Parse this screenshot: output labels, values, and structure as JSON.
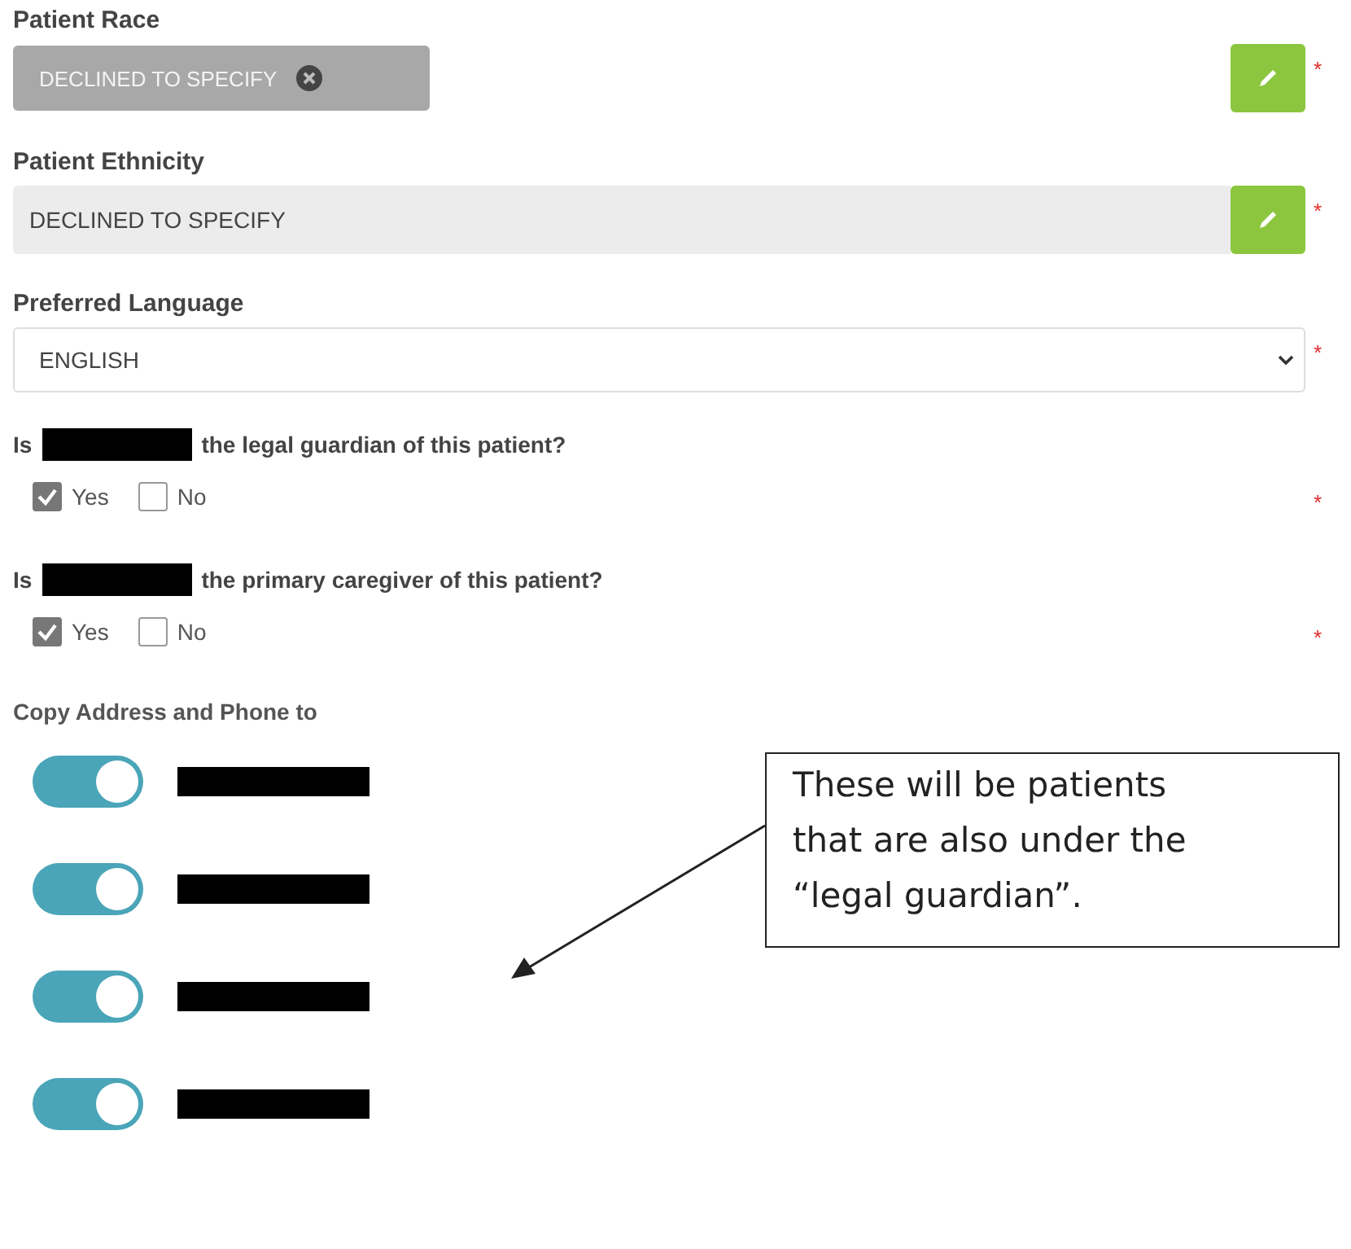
{
  "fields": [
    {
      "kind": "chip",
      "label": "Patient Race",
      "value": "DECLINED TO SPECIFY",
      "required_mark": "*"
    },
    {
      "kind": "text",
      "label": "Patient Ethnicity",
      "value": "DECLINED TO SPECIFY",
      "required_mark": "*"
    },
    {
      "kind": "select",
      "label": "Preferred Language",
      "value": "ENGLISH",
      "required_mark": "*"
    }
  ],
  "questions": [
    {
      "prefix": "Is",
      "text": "the legal guardian of this patient?",
      "required_mark": "*",
      "options": [
        {
          "label": "Yes",
          "checked": true
        },
        {
          "label": "No",
          "checked": false
        }
      ]
    },
    {
      "prefix": "Is",
      "text": "the primary caregiver of this patient?",
      "required_mark": "*",
      "options": [
        {
          "label": "Yes",
          "checked": true
        },
        {
          "label": "No",
          "checked": false
        }
      ]
    }
  ],
  "copy": {
    "label": "Copy Address and Phone to",
    "toggles": [
      {
        "on": true
      },
      {
        "on": true
      },
      {
        "on": true
      },
      {
        "on": true
      }
    ]
  },
  "callout": {
    "text": "These will be patients that are also under the “legal guardian”."
  }
}
